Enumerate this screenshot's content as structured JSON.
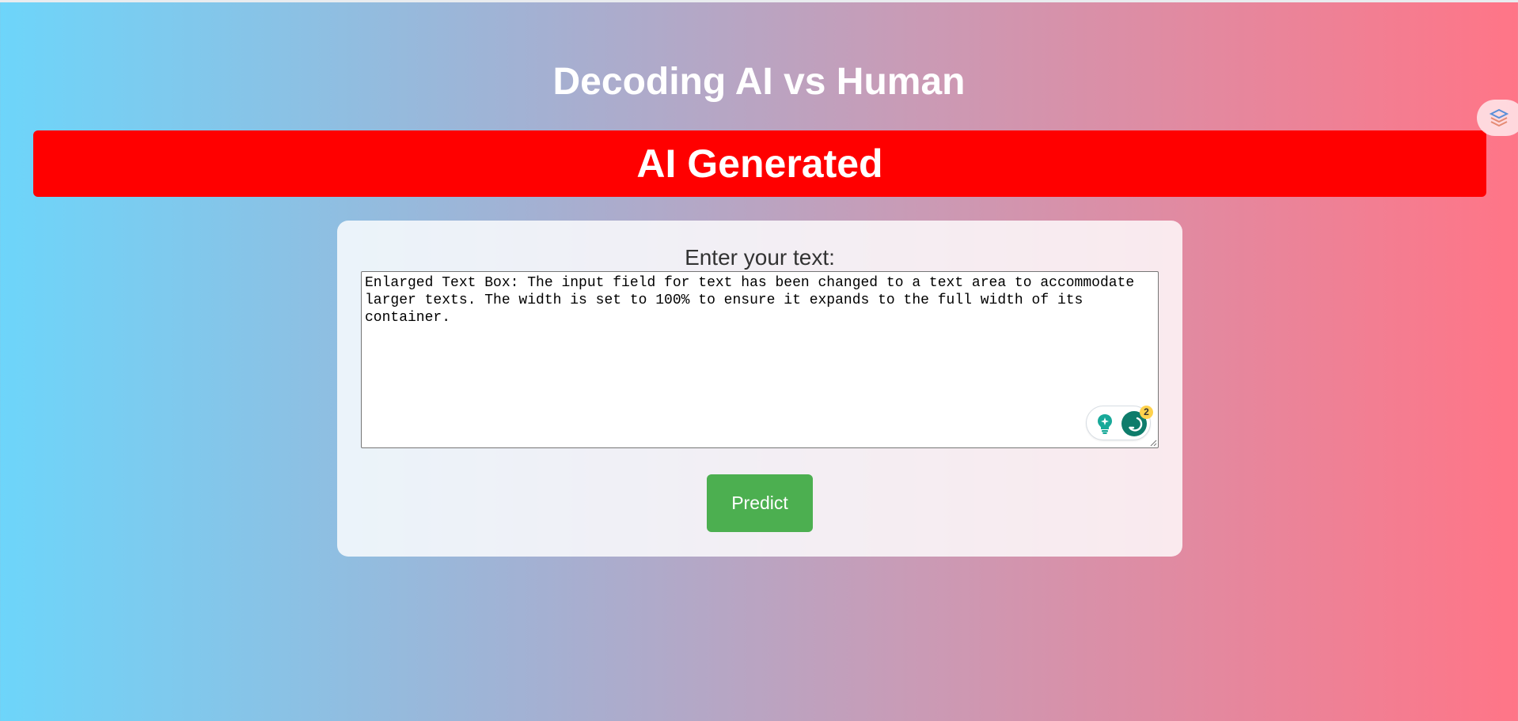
{
  "page": {
    "title": "Decoding AI vs Human"
  },
  "result": {
    "label": "AI Generated",
    "color": "#ff0000"
  },
  "form": {
    "label": "Enter your text:",
    "text_value": "Enlarged Text Box: The input field for text has been changed to a text area to accommodate larger texts. The width is set to 100% to ensure it expands to the full width of its container.",
    "submit_label": "Predict",
    "submit_color": "#4caf50"
  },
  "extension": {
    "badge_count": "2",
    "icons": [
      "lightbulb-sparkle-icon",
      "grammar-assistant-icon",
      "floating-extension-icon"
    ]
  },
  "colors": {
    "gradient_start": "#6dd5fa",
    "gradient_end": "#ff7587",
    "card_background": "#f3eff4"
  }
}
